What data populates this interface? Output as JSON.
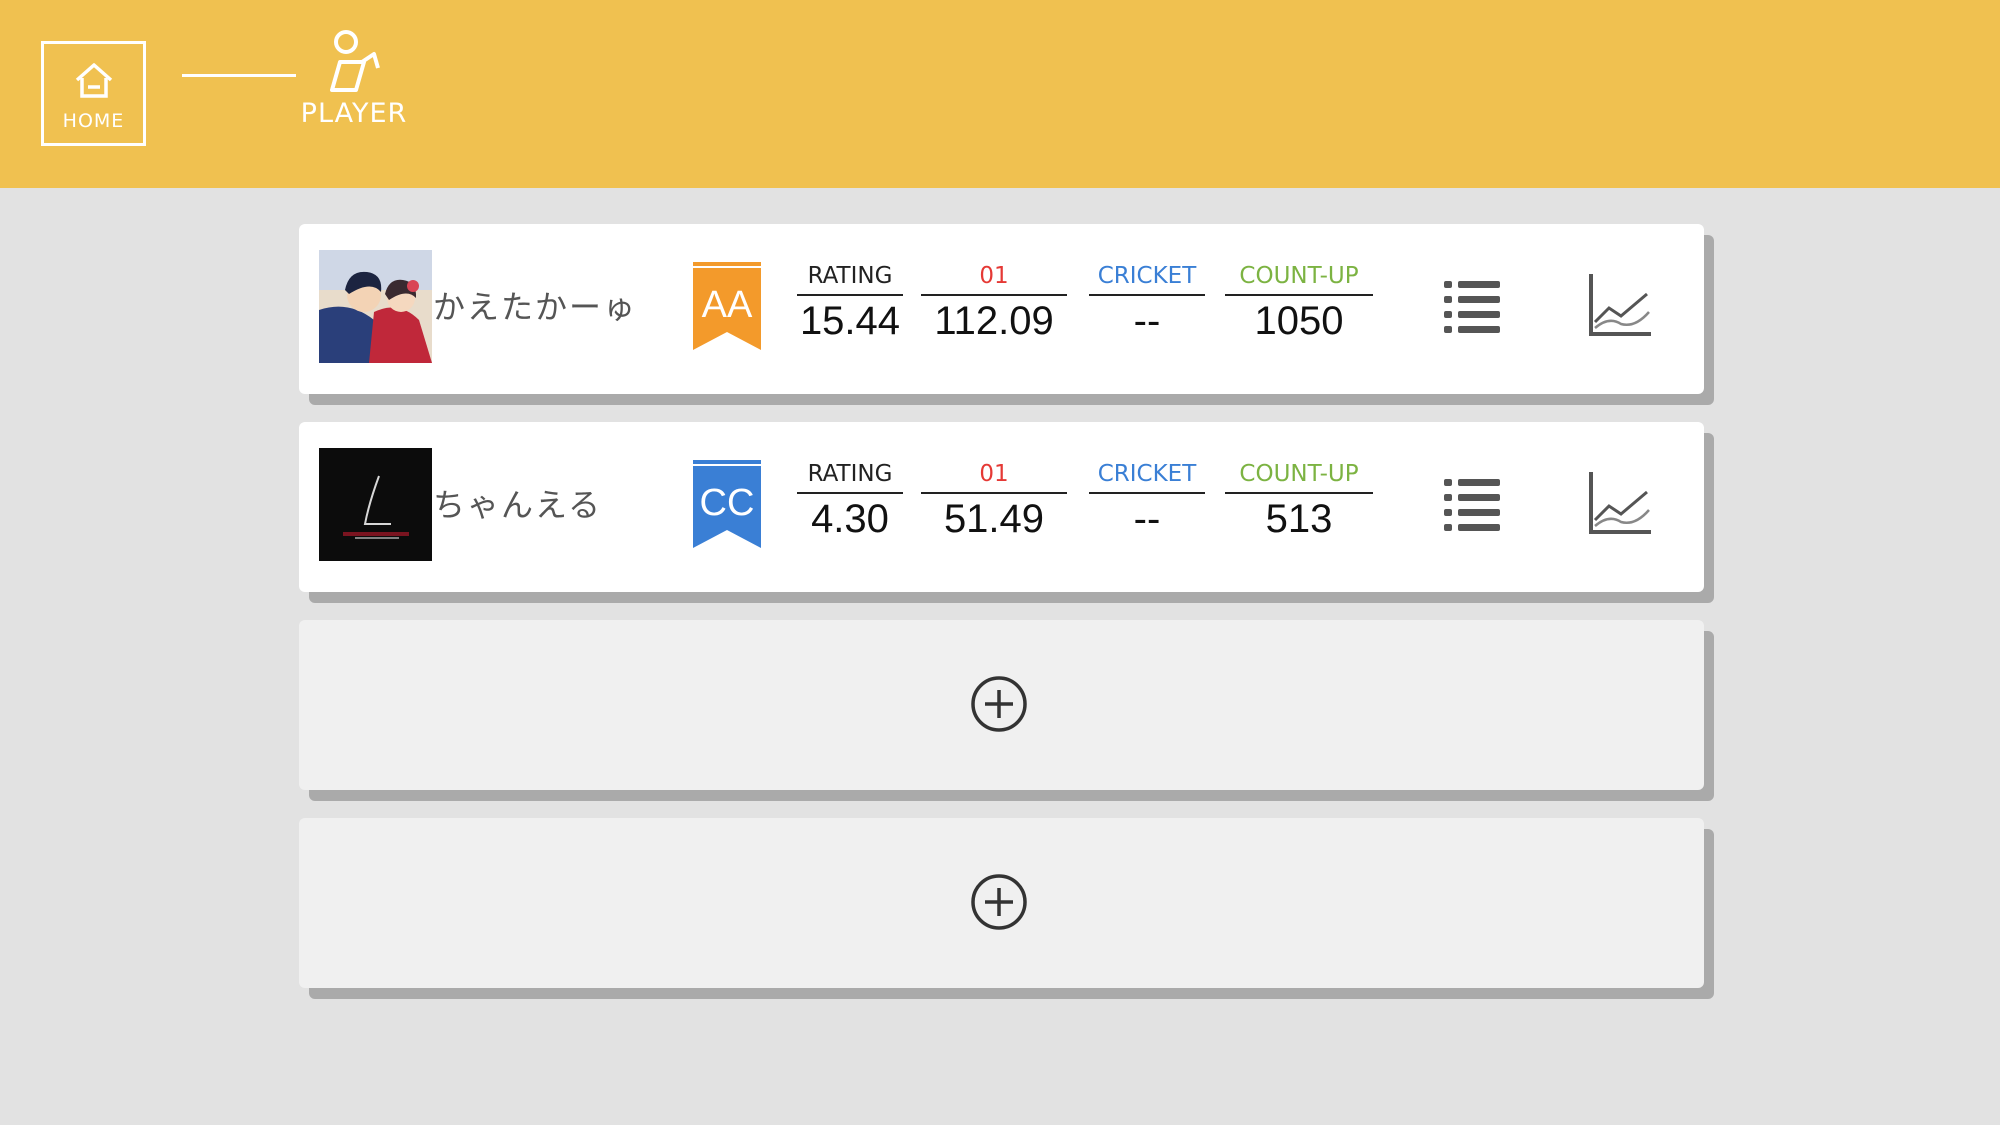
{
  "header": {
    "home_label": "HOME",
    "player_label": "PLAYER"
  },
  "players": [
    {
      "name": "かえたかーゅ",
      "rank": "AA",
      "rank_color": "#f39a2b",
      "rating_label": "RATING",
      "rating": "15.44",
      "zero_one_label": "01",
      "zero_one": "112.09",
      "cricket_label": "CRICKET",
      "cricket": "--",
      "countup_label": "COUNT-UP",
      "countup": "1050"
    },
    {
      "name": "ちゃんえる",
      "rank": "CC",
      "rank_color": "#3a7fd5",
      "rating_label": "RATING",
      "rating": "4.30",
      "zero_one_label": "01",
      "zero_one": "51.49",
      "cricket_label": "CRICKET",
      "cricket": "--",
      "countup_label": "COUNT-UP",
      "countup": "513"
    }
  ],
  "colors": {
    "header_bg": "#f0c150",
    "zero_one": "#e53935",
    "cricket": "#3a7fd5",
    "countup": "#7cb342"
  },
  "icons": [
    "home-icon",
    "player-icon",
    "list-icon",
    "graph-icon",
    "add-circle-icon"
  ]
}
